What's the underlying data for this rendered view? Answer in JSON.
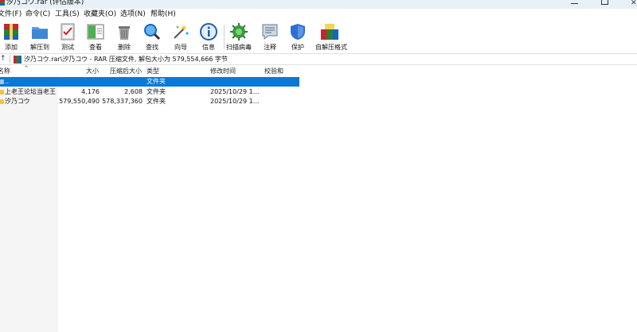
{
  "window": {
    "title": "汐乃コウ.rar (评估版本)"
  },
  "menu": [
    "文件(F)",
    "命令(C)",
    "工具(S)",
    "收藏夹(O)",
    "选项(N)",
    "帮助(H)"
  ],
  "toolbar": [
    {
      "label": "添加",
      "icon": "add-archive-icon"
    },
    {
      "label": "解压到",
      "icon": "extract-to-icon"
    },
    {
      "label": "测试",
      "icon": "test-icon"
    },
    {
      "label": "查看",
      "icon": "view-icon"
    },
    {
      "label": "删除",
      "icon": "delete-icon"
    },
    {
      "label": "查找",
      "icon": "find-icon"
    },
    {
      "label": "向导",
      "icon": "wizard-icon"
    },
    {
      "label": "信息",
      "icon": "info-icon"
    },
    {
      "label": "扫描病毒",
      "icon": "virus-scan-icon"
    },
    {
      "label": "注释",
      "icon": "comment-icon"
    },
    {
      "label": "保护",
      "icon": "protect-icon"
    },
    {
      "label": "自解压格式",
      "icon": "sfx-icon"
    }
  ],
  "address": {
    "path": "汐乃コウ.rar\\汐乃コウ - RAR 压缩文件, 解包大小为 579,554,666 字节"
  },
  "columns": {
    "name": "名称",
    "size": "大小",
    "packed": "压缩后大小",
    "type": "类型",
    "modified": "修改时间",
    "crc": "校验和"
  },
  "rows": [
    {
      "name": "..",
      "size": "",
      "packed": "",
      "type": "文件夹",
      "modified": "",
      "crc": "",
      "selected": true
    },
    {
      "name": "上老王论坛当老王",
      "size": "4,176",
      "packed": "2,608",
      "type": "文件夹",
      "modified": "2025/10/29 1...",
      "crc": "",
      "selected": false
    },
    {
      "name": "汐乃コウ",
      "size": "579,550,490",
      "packed": "578,337,360",
      "type": "文件夹",
      "modified": "2025/10/29 1...",
      "crc": "",
      "selected": false
    }
  ],
  "colors": {
    "selection": "#0a78d7",
    "titlebar": "#e9f1f8",
    "folder": "#f4c245"
  }
}
